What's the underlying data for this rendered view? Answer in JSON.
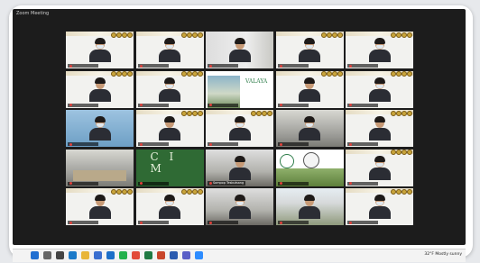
{
  "window": {
    "title": "Zoom Meeting"
  },
  "tiles": [
    {
      "name": "",
      "type": "person",
      "bg": "banner"
    },
    {
      "name": "",
      "type": "person",
      "bg": "banner"
    },
    {
      "name": "",
      "type": "person",
      "bg": "window"
    },
    {
      "name": "",
      "type": "person",
      "bg": "banner"
    },
    {
      "name": "",
      "type": "person",
      "bg": "banner"
    },
    {
      "name": "",
      "type": "person",
      "bg": "banner"
    },
    {
      "name": "",
      "type": "person",
      "bg": "banner"
    },
    {
      "name": "",
      "type": "slide-valaya"
    },
    {
      "name": "",
      "type": "person",
      "bg": "banner"
    },
    {
      "name": "",
      "type": "person",
      "bg": "banner"
    },
    {
      "name": "",
      "type": "person",
      "bg": "blue"
    },
    {
      "name": "",
      "type": "person",
      "bg": "banner"
    },
    {
      "name": "",
      "type": "person",
      "bg": "banner"
    },
    {
      "name": "",
      "type": "person",
      "bg": "room"
    },
    {
      "name": "",
      "type": "person",
      "bg": "banner"
    },
    {
      "name": "",
      "type": "room-empty"
    },
    {
      "name": "",
      "type": "slide-green"
    },
    {
      "name": "Sompop Tesbutsang",
      "type": "person",
      "bg": "dark"
    },
    {
      "name": "",
      "type": "slide-logo"
    },
    {
      "name": "",
      "type": "person",
      "bg": "banner"
    },
    {
      "name": "",
      "type": "person",
      "bg": "banner"
    },
    {
      "name": "",
      "type": "person",
      "bg": "banner"
    },
    {
      "name": "",
      "type": "person",
      "bg": "dark"
    },
    {
      "name": "",
      "type": "person",
      "bg": "outdoor"
    },
    {
      "name": "",
      "type": "person",
      "bg": "banner"
    }
  ],
  "valaya": {
    "title": "VALAYA"
  },
  "green_slide": {
    "letters": "C I M"
  },
  "taskbar": {
    "tray_text": "32°F Mostly sunny",
    "icons": [
      "start",
      "search",
      "task-view",
      "edge",
      "file-explorer",
      "store",
      "mail",
      "line",
      "chrome",
      "excel",
      "powerpoint",
      "word",
      "teams",
      "zoom"
    ],
    "icon_colors": [
      "#1f6fd1",
      "#666",
      "#444",
      "#1b7ac9",
      "#e8b53a",
      "#3a6fd0",
      "#1c6fc9",
      "#22b14c",
      "#e24b3a",
      "#1f7a43",
      "#c8452a",
      "#2b5cb0",
      "#5a5fc7",
      "#2d8cff"
    ]
  }
}
